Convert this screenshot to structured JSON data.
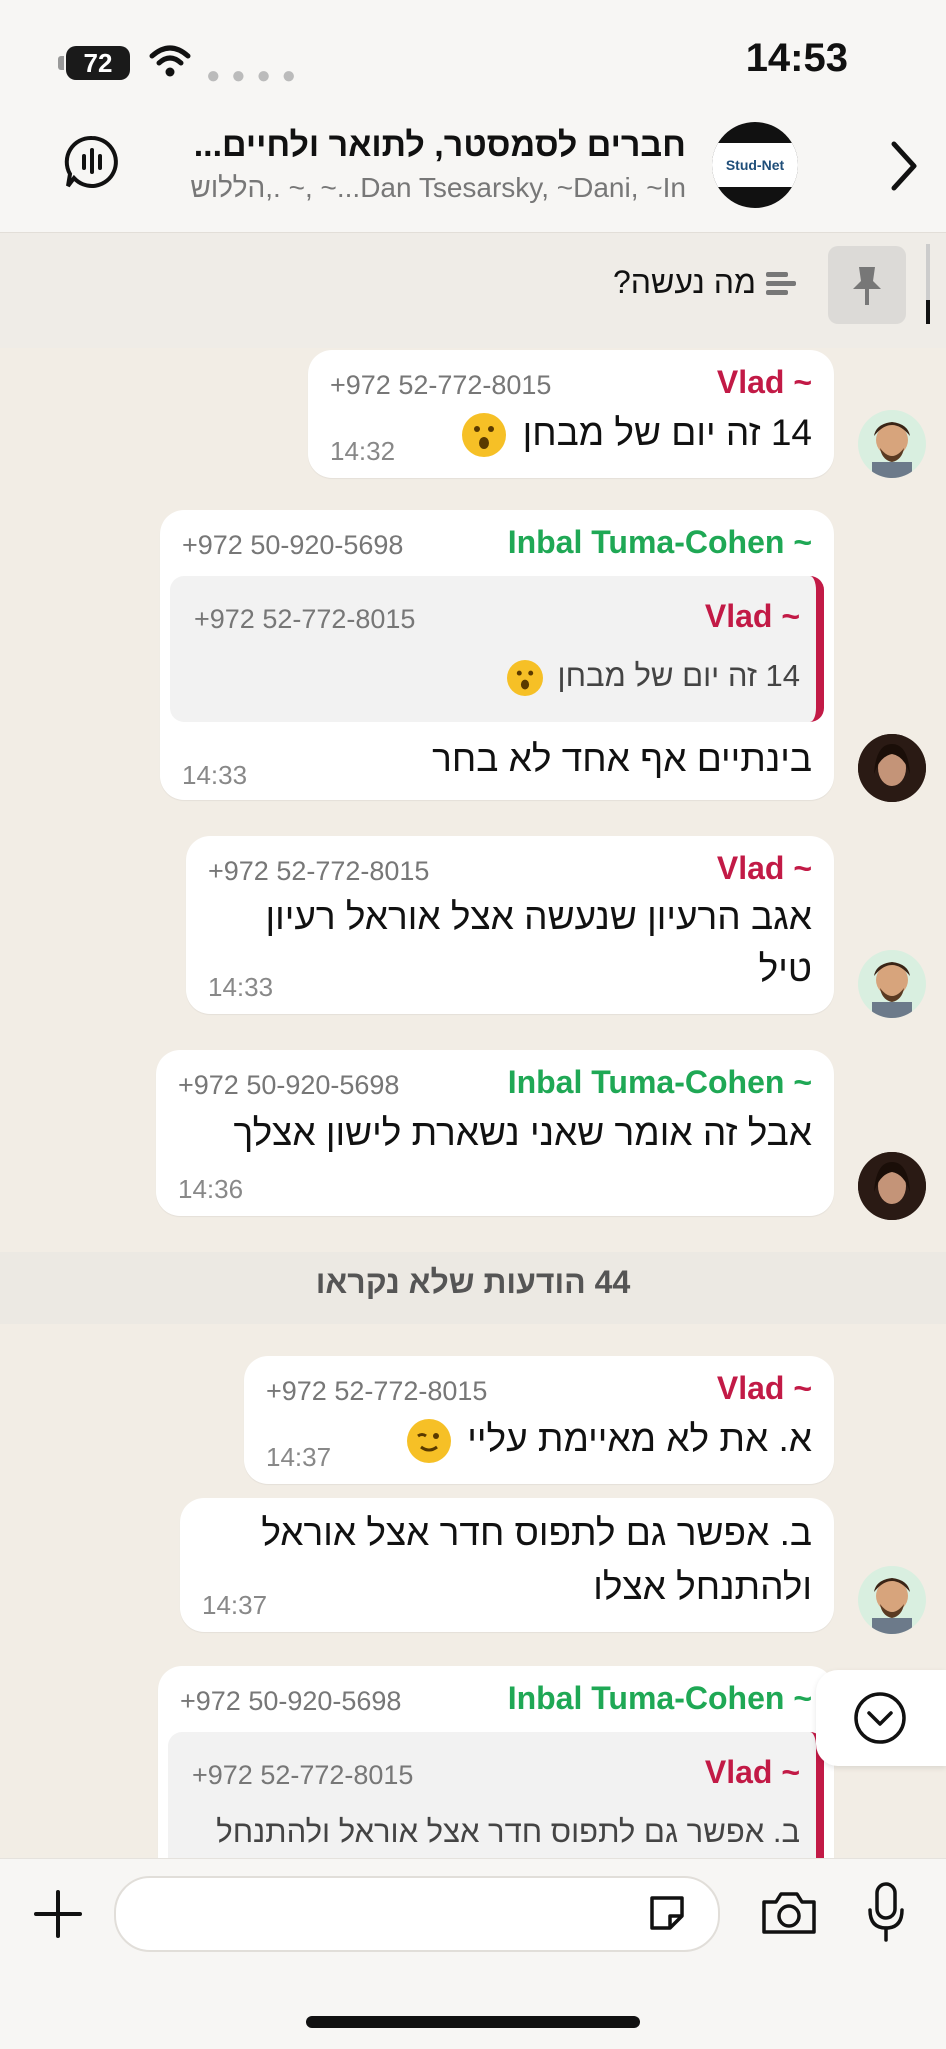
{
  "status": {
    "battery": "72",
    "time": "14:53"
  },
  "header": {
    "title": "חברים לסמסטר, לתואר ולחיים...",
    "subtitle": "Dan Tsesarsky, ~Dani, ~In...~ ,~ .,הללוש",
    "logo_text": "Stud-Net"
  },
  "pinned": {
    "text": "מה נעשה?"
  },
  "messages": [
    {
      "sender": "~ Vlad",
      "phone": "+972 52-772-8015",
      "text": "14 זה יום של מבחן",
      "emoji": "😮",
      "time": "14:32"
    },
    {
      "sender": "~ Inbal Tuma-Cohen",
      "phone": "+972 50-920-5698",
      "quote": {
        "sender": "~ Vlad",
        "phone": "+972 52-772-8015",
        "text": "14 זה יום של מבחן",
        "emoji": "😮"
      },
      "text": "בינתיים אף אחד לא בחר",
      "time": "14:33"
    },
    {
      "sender": "~ Vlad",
      "phone": "+972 52-772-8015",
      "text_line1": "אגב הרעיון שנעשה אצל אוראל רעיון",
      "text_line2": "טיל",
      "time": "14:33"
    },
    {
      "sender": "~ Inbal Tuma-Cohen",
      "phone": "+972 50-920-5698",
      "text": "אבל זה אומר שאני נשארת לישון אצלך",
      "time": "14:36"
    },
    {
      "sender": "~ Vlad",
      "phone": "+972 52-772-8015",
      "text": "א. את לא מאיימת עליי",
      "emoji": "😉",
      "time": "14:37"
    },
    {
      "text_line1": "ב. אפשר גם לתפוס חדר אצל אוראל",
      "text_line2": "ולהתנחל אצלו",
      "time": "14:37"
    },
    {
      "sender": "~ Inbal Tuma-Cohen",
      "phone": "+972 50-920-5698",
      "quote": {
        "sender": "~ Vlad",
        "phone": "+972 52-772-8015",
        "text": "ב. אפשר גם לתפוס חדר אצל אוראל ולהתנחל"
      }
    }
  ],
  "unread_divider": "44 הודעות שלא נקראו",
  "colors": {
    "vlad": "#c21a46",
    "inbal": "#1fa855"
  },
  "icons": [
    "battery-icon",
    "wifi-icon",
    "group-audio-icon",
    "chevron-right-icon",
    "pin-icon",
    "pinned-list-icon",
    "scroll-down-icon",
    "plus-icon",
    "sticker-icon",
    "camera-icon",
    "microphone-icon"
  ]
}
